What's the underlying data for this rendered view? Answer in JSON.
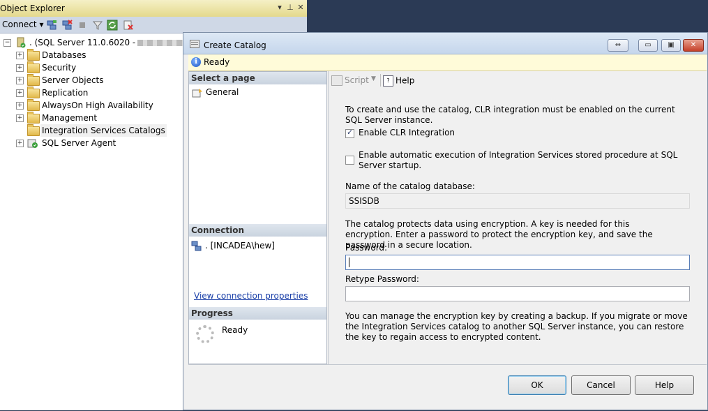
{
  "object_explorer": {
    "title": "Object Explorer",
    "connect_label": "Connect",
    "tree": {
      "server_label": ". (SQL Server 11.0.6020 -",
      "items": [
        {
          "label": "Databases",
          "expandable": true
        },
        {
          "label": "Security",
          "expandable": true
        },
        {
          "label": "Server Objects",
          "expandable": true
        },
        {
          "label": "Replication",
          "expandable": true
        },
        {
          "label": "AlwaysOn High Availability",
          "expandable": true
        },
        {
          "label": "Management",
          "expandable": true
        },
        {
          "label": "Integration Services Catalogs",
          "expandable": false
        },
        {
          "label": "SQL Server Agent",
          "expandable": true
        }
      ]
    }
  },
  "dialog": {
    "title": "Create Catalog",
    "status": "Ready",
    "select_page_header": "Select a page",
    "pages": [
      "General"
    ],
    "connection_header": "Connection",
    "connection_value": ". [INCADEA\\hew]",
    "view_connection_link": "View connection properties",
    "progress_header": "Progress",
    "progress_status": "Ready",
    "toolbar": {
      "script_label": "Script",
      "help_label": "Help"
    },
    "content": {
      "clr_info": "To create and use the catalog, CLR integration must be enabled on the current SQL Server instance.",
      "enable_clr_label": "Enable CLR Integration",
      "enable_clr_checked": true,
      "auto_exec_label": "Enable automatic execution of Integration Services stored procedure at SQL Server startup.",
      "auto_exec_checked": false,
      "catalog_db_label": "Name of the catalog database:",
      "catalog_db_value": "SSISDB",
      "encryption_info": "The catalog protects data using encryption. A key is needed for this encryption. Enter a password to protect the encryption key, and save the password in a secure location.",
      "password_label": "Password:",
      "password_value": "",
      "retype_password_label": "Retype Password:",
      "retype_password_value": "",
      "backup_info": "You can manage the encryption key by creating a backup. If you migrate or move the Integration Services catalog to another SQL Server instance, you can restore the key to regain access to encrypted content."
    },
    "buttons": {
      "ok": "OK",
      "cancel": "Cancel",
      "help": "Help"
    }
  }
}
